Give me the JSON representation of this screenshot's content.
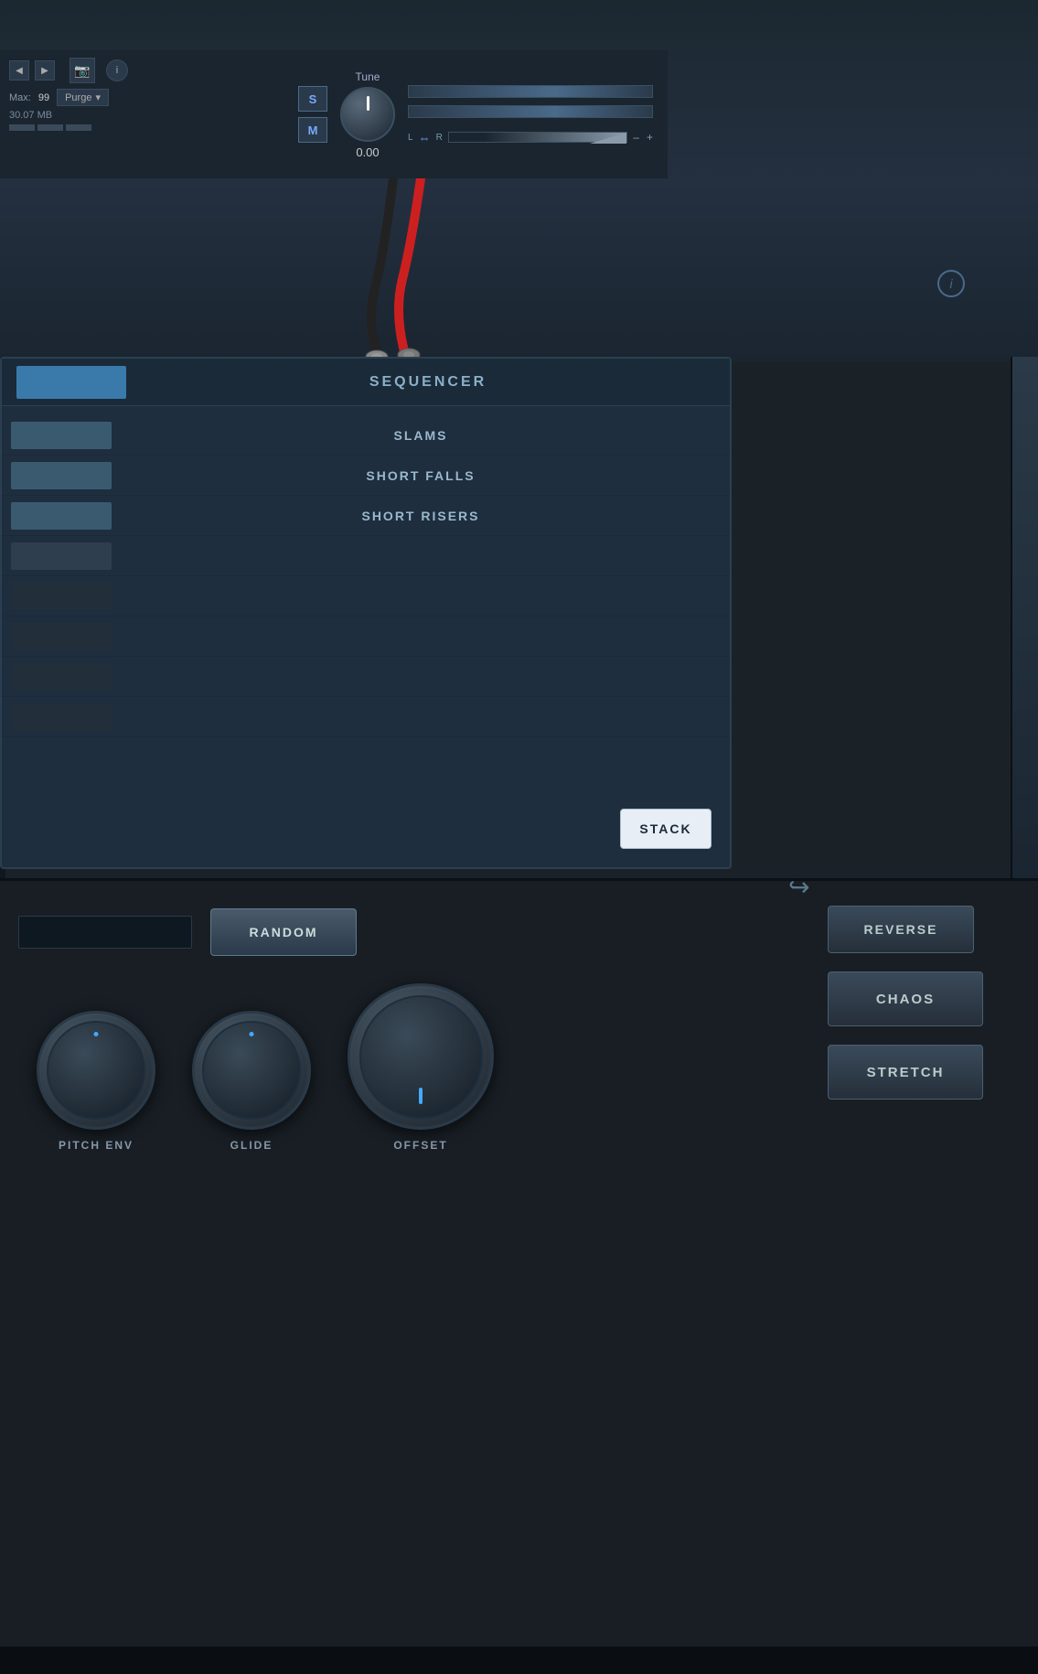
{
  "header": {
    "max_label": "Max:",
    "max_value": "99",
    "purge_label": "Purge",
    "mb_label": "30.07 MB",
    "tune_label": "Tune",
    "tune_value": "0.00",
    "s_label": "S",
    "m_label": "M",
    "l_label": "L",
    "r_label": "R",
    "plus_label": "+",
    "minus_label": "–",
    "info_label": "i"
  },
  "sequencer": {
    "title": "SEQUENCER",
    "tab_label": "",
    "stack_label": "STACK",
    "rows": [
      {
        "label": "",
        "name": "SLAMS",
        "style": "active"
      },
      {
        "label": "",
        "name": "SHORT FALLS",
        "style": "active"
      },
      {
        "label": "",
        "name": "SHORT RISERS",
        "style": "active"
      },
      {
        "label": "",
        "name": "",
        "style": "empty"
      },
      {
        "label": "",
        "name": "",
        "style": "empty"
      },
      {
        "label": "",
        "name": "",
        "style": "empty"
      },
      {
        "label": "",
        "name": "",
        "style": "empty"
      },
      {
        "label": "",
        "name": "",
        "style": "empty"
      }
    ]
  },
  "controls": {
    "random_label": "RANDOM",
    "reverse_label": "REVERSE",
    "chaos_label": "CHAOS",
    "stretch_label": "STRETCH",
    "return_arrow": "↩"
  },
  "knobs": [
    {
      "label": "PITCH ENV",
      "dot_position": "top"
    },
    {
      "label": "GLIDE",
      "dot_position": "top"
    },
    {
      "label": "OFFSET",
      "dot_position": "center"
    }
  ],
  "info_circle": "i"
}
